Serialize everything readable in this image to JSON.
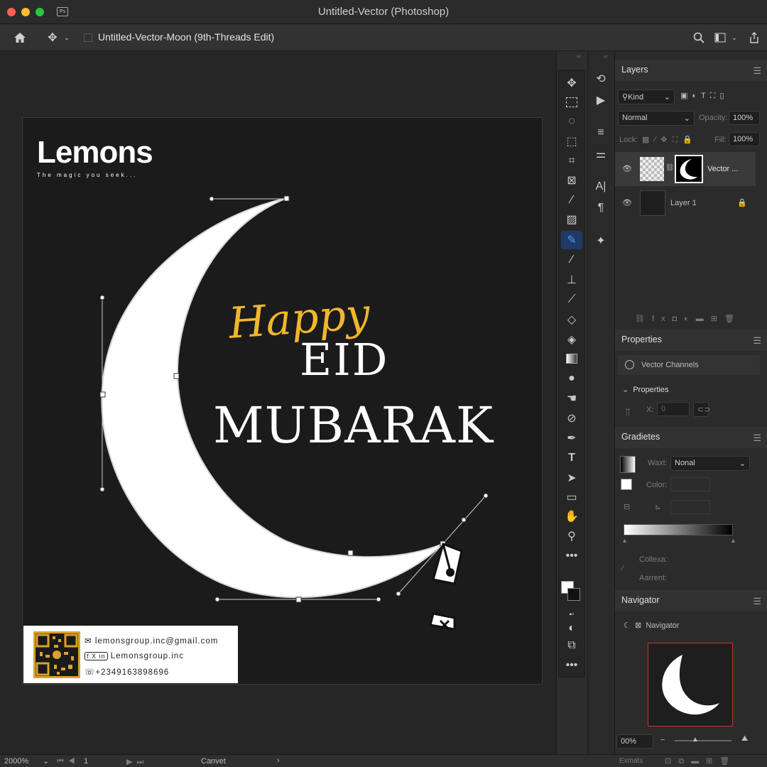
{
  "window": {
    "title": "Untitled-Vector (Photoshop)",
    "document_tab": "Untitled-Vector-Moon (9th-Threads Edit)"
  },
  "colors": {
    "accent_blue": "#1473e6",
    "moon": "#ffffff",
    "happy_text": "#f0b62e",
    "canvas": "#1b1b1b"
  },
  "poster": {
    "logo": "Lemons",
    "tagline": "The magic you seek...",
    "happy": "Happy",
    "eid": "EID",
    "mubarak": "MUBARAK",
    "contact": {
      "email": "lemonsgroup.inc@gmail.com",
      "social": "Lemonsgroup.inc",
      "social_icons": "f X in",
      "phone": "+2349163898696"
    }
  },
  "layers_panel": {
    "tab": "Layers",
    "filter_kind": "Kind",
    "blend_mode": "Normal",
    "opacity_label": "Opacity:",
    "opacity_value": "100%",
    "lock_label": "Lock:",
    "fill_label": "Fill:",
    "fill_value": "100%",
    "layers": [
      {
        "name": "Vector ...",
        "visible": true
      },
      {
        "name": "Layer 1",
        "visible": true,
        "locked": true
      }
    ]
  },
  "properties_panel": {
    "tab": "Properties",
    "channels_label": "Vector Channels",
    "section": "Properties",
    "x_label": "X:",
    "x_value": "0"
  },
  "gradients_panel": {
    "tab": "Gradietes",
    "waxt_label": "Waxt:",
    "waxt_value": "Nonal",
    "color_label": "Color:",
    "collexa_label": "Collexa:",
    "aarrent_label": "Aarrent:"
  },
  "navigator_panel": {
    "tab": "Navigator",
    "item_label": "Navigator",
    "zoom": "00%"
  },
  "status": {
    "zoom": "2000%",
    "page": "1",
    "canvas_label": "Canvet",
    "bottom_left": "Exmats"
  }
}
